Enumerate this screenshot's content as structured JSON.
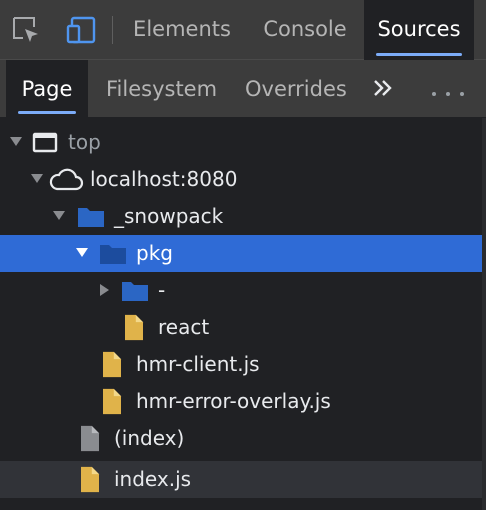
{
  "toolbar": {
    "inspect_icon": "inspect-element-icon",
    "device_icon": "device-toolbar-icon"
  },
  "main_tabs": [
    {
      "label": "Elements",
      "active": false
    },
    {
      "label": "Console",
      "active": false
    },
    {
      "label": "Sources",
      "active": true
    }
  ],
  "sub_tabs": [
    {
      "label": "Page",
      "active": true
    },
    {
      "label": "Filesystem",
      "active": false
    },
    {
      "label": "Overrides",
      "active": false
    }
  ],
  "sub_more_icon": "chevron-double-right-icon",
  "sub_kebab_icon": "more-horizontal-icon",
  "tree": [
    {
      "label": "top",
      "icon": "frame-icon",
      "expanded": true
    },
    {
      "label": "localhost:8080",
      "icon": "cloud-icon",
      "expanded": true
    },
    {
      "label": "_snowpack",
      "icon": "folder-icon",
      "expanded": true
    },
    {
      "label": "pkg",
      "icon": "folder-icon",
      "expanded": true,
      "selected": true
    },
    {
      "label": "-",
      "icon": "folder-icon",
      "expanded": false
    },
    {
      "label": "react",
      "icon": "file-js-icon"
    },
    {
      "label": "hmr-client.js",
      "icon": "file-js-icon"
    },
    {
      "label": "hmr-error-overlay.js",
      "icon": "file-js-icon"
    },
    {
      "label": "(index)",
      "icon": "file-document-icon"
    },
    {
      "label": "index.js",
      "icon": "file-js-icon",
      "hovered": true
    }
  ],
  "colors": {
    "accent": "#7cacf8",
    "selection": "#2f6bd6",
    "folder": "#2b66c4",
    "file_js": "#e0b34a",
    "file_doc": "#9aa0a6"
  }
}
